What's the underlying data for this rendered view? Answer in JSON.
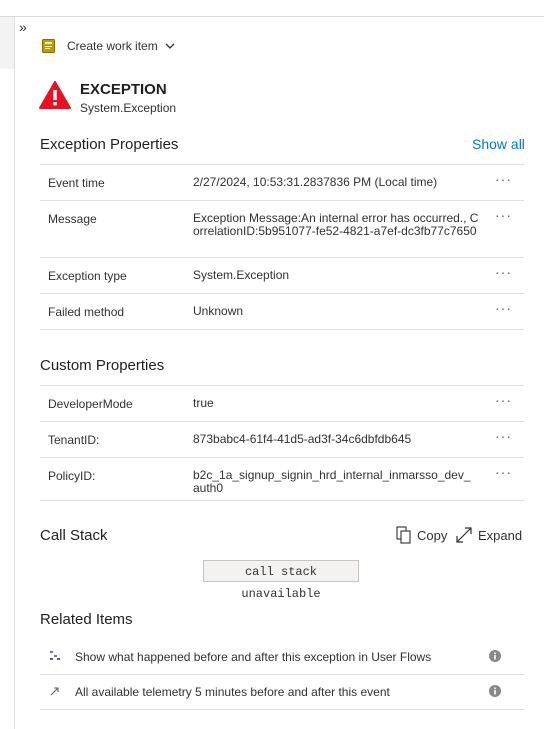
{
  "header": {
    "collapse_glyph": "»",
    "create_work_item": "Create work item"
  },
  "exception": {
    "title": "EXCEPTION",
    "subtitle": "System.Exception"
  },
  "exception_properties": {
    "title": "Exception Properties",
    "show_all": "Show all",
    "rows": [
      {
        "key": "Event time",
        "value": "2/27/2024, 10:53:31.2837836 PM (Local time)"
      },
      {
        "key": "Message",
        "value": "Exception Message:An internal error has occurred., CorrelationID:5b951077-fe52-4821-a7ef-dc3fb77c7650"
      },
      {
        "key": "Exception type",
        "value": "System.Exception"
      },
      {
        "key": "Failed method",
        "value": "Unknown"
      }
    ]
  },
  "custom_properties": {
    "title": "Custom Properties",
    "rows": [
      {
        "key": "DeveloperMode",
        "value": "true"
      },
      {
        "key": "TenantID:",
        "value": "873babc4-61f4-41d5-ad3f-34c6dbfdb645"
      },
      {
        "key": "PolicyID:",
        "value": "b2c_1a_signup_signin_hrd_internal_inmarsso_dev_auth0"
      }
    ]
  },
  "more_glyph": "···",
  "call_stack": {
    "title": "Call Stack",
    "copy": "Copy",
    "expand": "Expand",
    "content": "call stack unavailable"
  },
  "related": {
    "title": "Related Items",
    "items": [
      {
        "icon": "user-flows-icon",
        "label": "Show what happened before and after this exception in User Flows"
      },
      {
        "icon": "arrow-icon",
        "label": "All available telemetry 5 minutes before and after this event"
      }
    ]
  },
  "colors": {
    "accent": "#0078d4",
    "error": "#e81123",
    "work_item": "#c19c00"
  }
}
